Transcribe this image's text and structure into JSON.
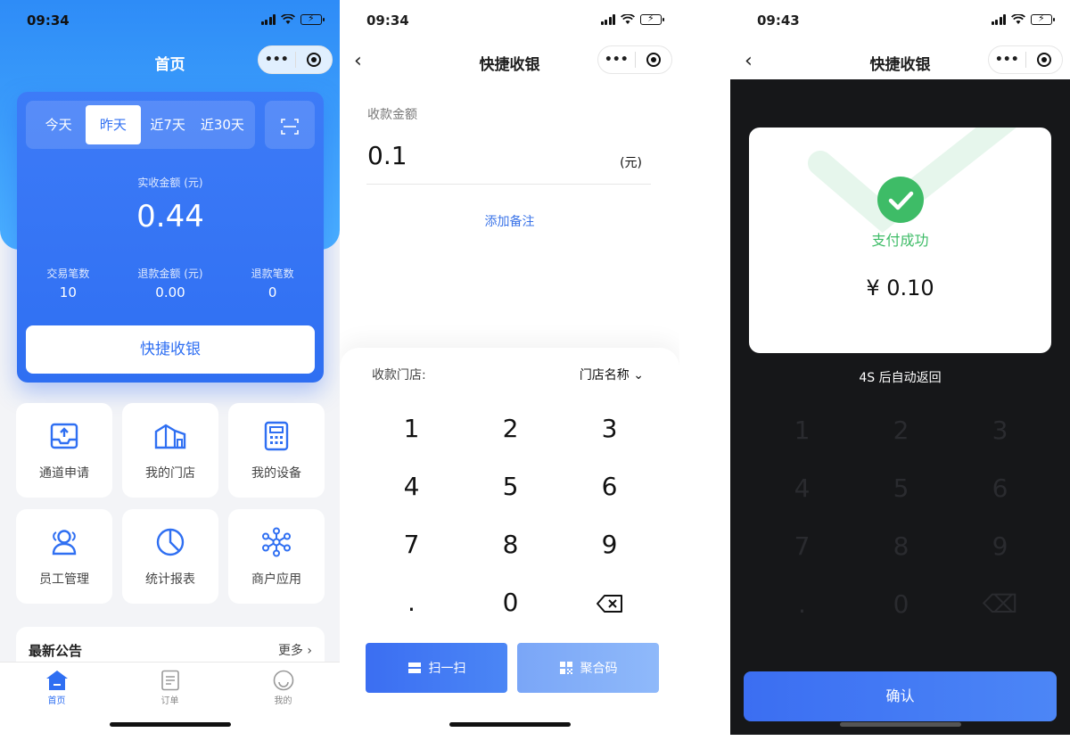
{
  "colors": {
    "primary": "#2f6ff2",
    "success": "#3ebc67",
    "header_gradient_top": "#2e8cf7",
    "header_gradient_bottom": "#4ab0ff"
  },
  "screen_home": {
    "time": "09:34",
    "title": "首页",
    "capsule": {
      "more_icon": "more-dots-icon",
      "close_icon": "target-icon"
    },
    "ranges": [
      "今天",
      "昨天",
      "近7天",
      "近30天"
    ],
    "active_range": "昨天",
    "scan_icon": "scan-icon",
    "received_label": "实收金额 (元)",
    "received_amount": "0.44",
    "stats": [
      {
        "label": "交易笔数",
        "value": "10"
      },
      {
        "label": "退款金额 (元)",
        "value": "0.00"
      },
      {
        "label": "退款笔数",
        "value": "0"
      }
    ],
    "quick_cashier": "快捷收银",
    "tiles": [
      {
        "label": "通道申请",
        "icon": "upload-tray-icon"
      },
      {
        "label": "我的门店",
        "icon": "store-icon"
      },
      {
        "label": "我的设备",
        "icon": "calculator-icon"
      },
      {
        "label": "员工管理",
        "icon": "staff-icon"
      },
      {
        "label": "统计报表",
        "icon": "pie-chart-icon"
      },
      {
        "label": "商户应用",
        "icon": "apps-network-icon"
      }
    ],
    "notice_title": "最新公告",
    "notice_more": "更多",
    "tabbar": [
      {
        "label": "首页",
        "icon": "home-icon",
        "active": true
      },
      {
        "label": "订单",
        "icon": "order-icon",
        "active": false
      },
      {
        "label": "我的",
        "icon": "profile-smile-icon",
        "active": false
      }
    ]
  },
  "screen_cashier": {
    "time": "09:34",
    "title": "快捷收银",
    "amount_label": "收款金额",
    "amount_value": "0.1",
    "amount_unit": "(元)",
    "add_remark": "添加备注",
    "store_label": "收款门店:",
    "store_value": "门店名称",
    "keys": [
      "1",
      "2",
      "3",
      "4",
      "5",
      "6",
      "7",
      "8",
      "9",
      ".",
      "0"
    ],
    "delete_icon": "backspace-icon",
    "scan_button": "扫一扫",
    "qr_button": "聚合码"
  },
  "screen_success": {
    "time": "09:43",
    "title": "快捷收银",
    "status": "支付成功",
    "amount": "¥ 0.10",
    "auto_return": "4S 后自动返回",
    "confirm": "确认"
  }
}
